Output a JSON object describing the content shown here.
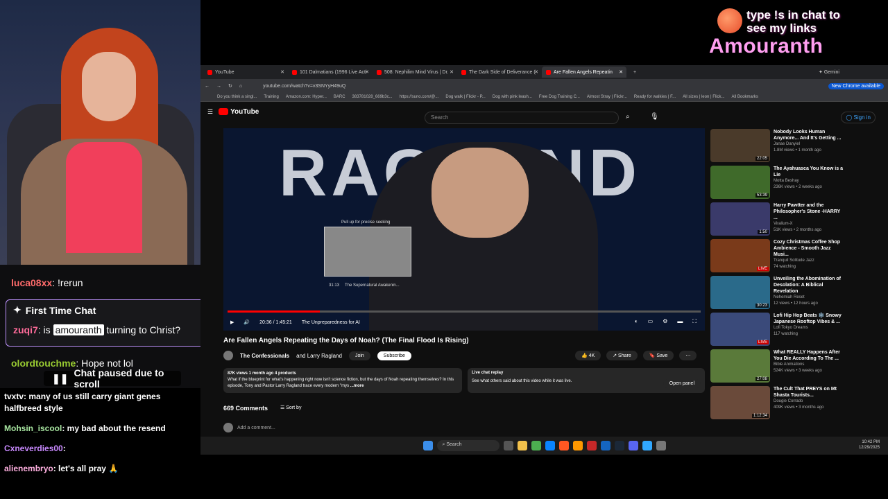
{
  "overlay": {
    "links": "type !s in chat to see my links",
    "name": "Amouranth"
  },
  "chat": {
    "line1_user": "luca08xx",
    "line1_msg": ": !rerun",
    "ftc_title": "First Time Chat",
    "ftc_user": "zuqi7",
    "ftc_pre": ": is ",
    "ftc_mention": "amouranth",
    "ftc_post": " turning to Christ?",
    "line3_user": "olordtouchme",
    "line3_msg": ": Hope not lol",
    "paused": "Chat paused due to scroll",
    "lower": [
      {
        "user": "tvxtv",
        "msg": ": many of us still carry giant genes halfbreed style"
      },
      {
        "user": "Mohsin_iscool",
        "msg": ": my bad about the resend"
      },
      {
        "user": "Cxneverdies00",
        "msg": ":"
      },
      {
        "user": "alienembryo",
        "msg": ": let's all pray 🙏"
      }
    ]
  },
  "browser": {
    "tabs": [
      "YouTube",
      "101 Dalmatians (1996 Live Acti",
      "508: Nephilim Mind Virus | Dr.",
      "The Dark Side of Deliverance (",
      "Are Fallen Angels Repeatin"
    ],
    "gemini": "Gemini",
    "url": "youtube.com/watch?v=v3SNYyH49uQ",
    "chrome_avail": "New Chrome available",
    "bookmarks": [
      "Do you think a singl...",
      "Training",
      "Amazon.com: Hyper...",
      "BARC",
      "383781028_669b3c...",
      "https://suno.com/@...",
      "Dog walk | Flickr - P...",
      "Dog with pink leash...",
      "Free Dog Training C...",
      "Almost Stray | Flickr...",
      "Ready for walkies | F...",
      "All sizes | leon | Flick..."
    ],
    "all_bookmarks": "All Bookmarks"
  },
  "yt": {
    "logo": "YouTube",
    "search_placeholder": "Search",
    "signin": "Sign in",
    "video_banner": "RAGLAND",
    "preview_hint": "Pull up for precise seeking",
    "preview_time": "31:13",
    "preview_chapter": "The Supernatural Awakenin...",
    "time": "20:36 / 1:45:21",
    "chapter": "The Unpreparedness for AI",
    "progress": 0.195,
    "title": "Are Fallen Angels Repeating the Days of Noah? (The Final Flood Is Rising)",
    "channel": "The Confessionals",
    "collab": "and Larry Ragland",
    "join": "Join",
    "subscribe": "Subscribe",
    "likes": "4K",
    "share": "Share",
    "save": "Save",
    "views": "87K views  1 month ago  4 products",
    "desc": "What if the blueprint for what's happening right now isn't science fiction, but the days of Noah repeating themselves? In this episode, Tony and Pastor Larry Ragland trace every modern \"mys",
    "more": "...more",
    "livechat_title": "Live chat replay",
    "livechat_desc": "See what others said about this video while it was live.",
    "open_panel": "Open panel",
    "comments": "669 Comments",
    "sort": "Sort by",
    "add_comment": "Add a comment...",
    "sidebar": [
      {
        "title": "Nobody Looks Human Anymore... And It's Getting ...",
        "channel": "Janae Danyiel",
        "meta": "1.8M views • 1 month ago",
        "dur": "22:05",
        "color": "#4a3a2a"
      },
      {
        "title": "The Ayahuasca You Know is a Lie",
        "channel": "Motta Beshay",
        "meta": "236K views • 2 weeks ago",
        "dur": "53:39",
        "color": "#3f6a2a"
      },
      {
        "title": "Harry Pawtter and the Philosopher's Stone -HARRY ...",
        "channel": "Viralium-X",
        "meta": "51K views • 2 months ago",
        "dur": "1:50",
        "color": "#3a3a6a"
      },
      {
        "title": "Cozy Christmas Coffee Shop Ambience - Smooth Jazz Musi...",
        "channel": "Tranquil Solitude Jazz",
        "meta": "74 watching",
        "dur": "LIVE",
        "color": "#7a3a1a"
      },
      {
        "title": "Unveiling the Abomination of Desolation: A Biblical Revelation",
        "channel": "Nehemiah Reset",
        "meta": "12 views • 12 hours ago",
        "dur": "30:23",
        "color": "#2a6a8a"
      },
      {
        "title": "Lofi Hip Hop Beats ❄️ Snowy Japanese Rooftop Vibes & ...",
        "channel": "Lofi Tokyo Dreams",
        "meta": "117 watching",
        "dur": "LIVE",
        "color": "#3a4a7a"
      },
      {
        "title": "What REALLY Happens After You Die According To The ...",
        "channel": "Bible Animations",
        "meta": "524K views • 3 weeks ago",
        "dur": "27:08",
        "color": "#5a7a3a"
      },
      {
        "title": "The Cult That PREYS on Mt Shasta Tourists...",
        "channel": "Dougie Corrado",
        "meta": "409K views • 3 months ago",
        "dur": "1:12:34",
        "color": "#6a4a3a"
      }
    ]
  },
  "taskbar": {
    "search": "Search",
    "time": "10:42 PM",
    "date": "12/29/2025"
  }
}
